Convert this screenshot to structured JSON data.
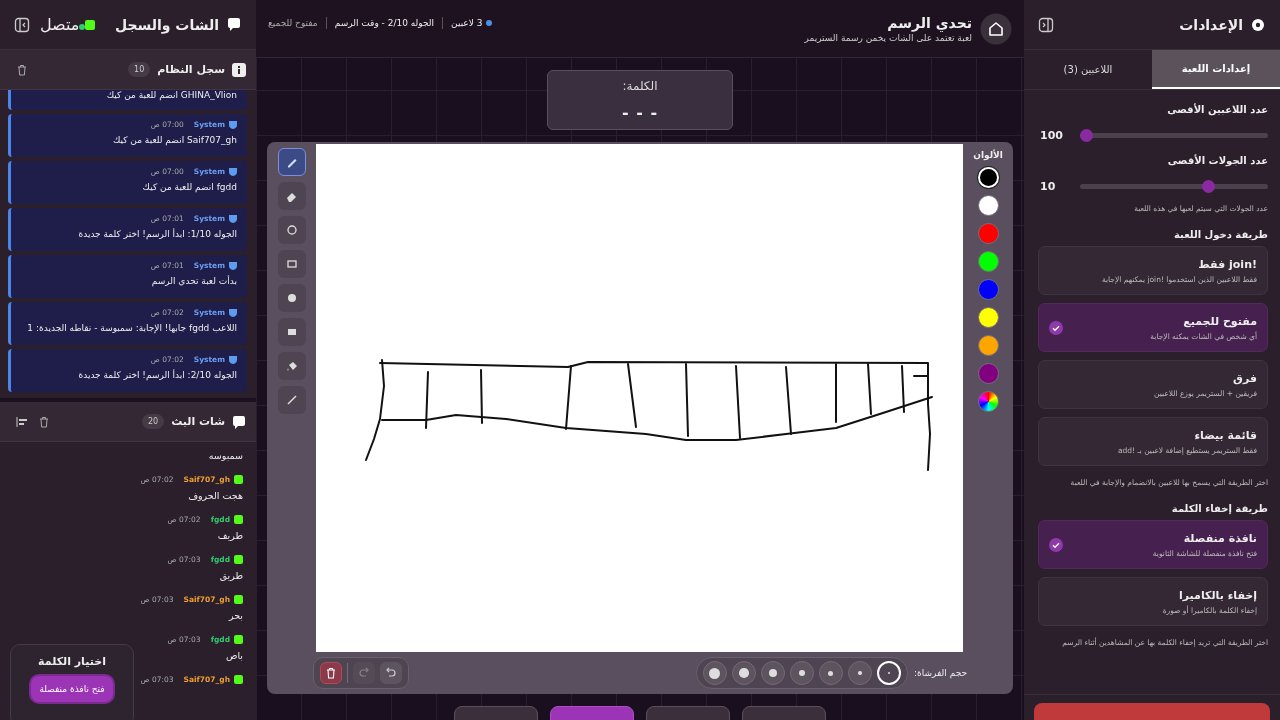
{
  "settings": {
    "title": "الإعدادات",
    "tabs": [
      {
        "label": "إعدادات اللعبة",
        "selected": true
      },
      {
        "label": "اللاعبين (3)",
        "selected": false
      }
    ],
    "sliders": [
      {
        "label": "عدد اللاعبين الأقصى",
        "value": "100"
      },
      {
        "label": "عدد الجولات الأقصى",
        "value": "10",
        "hint": "عدد الجولات التي سيتم لعبها في هذه اللعبة"
      }
    ],
    "groups": [
      {
        "title": "طريقة دخول اللعبة",
        "hint": "اختر الطريقة التي يسمح بها للاعبين بالانضمام والإجابة في اللعبة",
        "options": [
          {
            "title": "!join فقط",
            "description": "فقط اللاعبين الذين استخدموا !join يمكنهم الإجابة",
            "selected": false
          },
          {
            "title": "مفتوح للجميع",
            "description": "أي شخص في الشات يمكنه الإجابة",
            "selected": true
          },
          {
            "title": "فرق",
            "description": "فريقين + الستريمر يوزع اللاعبين",
            "selected": false
          },
          {
            "title": "قائمة بيضاء",
            "description": "فقط الستريمر يستطيع إضافة لاعبين بـ !add",
            "selected": false
          }
        ]
      },
      {
        "title": "طريقة إخفاء الكلمة",
        "hint": "اختر الطريقة التي تريد إخفاء الكلمة بها عن المشاهدين أثناء الرسم",
        "options": [
          {
            "title": "نافذة منفصلة",
            "description": "فتح نافذة منفصلة للشاشة الثانوية",
            "selected": true
          },
          {
            "title": "إخفاء بالكاميرا",
            "description": "إخفاء الكلمة بالكاميرا أو صورة",
            "selected": false
          }
        ]
      }
    ],
    "footer_button": {
      "kind": "danger"
    }
  },
  "header": {
    "title": "تحدي الرسم",
    "subtitle": "لعبة تعتمد على الشات يخمن رسمة الستريمر",
    "players": "3 لاعبين",
    "round": "الجوله 2/10 - وقت الرسم",
    "mode": "مفتوح للجميع"
  },
  "word_box": {
    "label": "الكلمة:",
    "value": "- - -"
  },
  "palette": {
    "title": "الألوان",
    "colors": [
      {
        "color": "#000000",
        "selected": true
      },
      {
        "color": "#ffffff",
        "selected": false
      },
      {
        "color": "#ff0000",
        "selected": false
      },
      {
        "color": "#00ff00",
        "selected": false
      },
      {
        "color": "#0000ff",
        "selected": false
      },
      {
        "color": "#ffff00",
        "selected": false
      },
      {
        "color": "#ffa500",
        "selected": false
      },
      {
        "color": "#800080",
        "selected": false
      },
      {
        "kind": "custom",
        "selected": false
      }
    ]
  },
  "tools": [
    {
      "kind": "pen",
      "selected": true
    },
    {
      "kind": "eraser",
      "selected": false
    },
    {
      "kind": "circle",
      "selected": false
    },
    {
      "kind": "rect",
      "selected": false
    },
    {
      "kind": "circle-fill",
      "selected": false
    },
    {
      "kind": "rect-fill",
      "selected": false
    },
    {
      "kind": "bucket",
      "selected": false
    },
    {
      "kind": "line",
      "selected": false
    }
  ],
  "brush": {
    "label": "حجم الفرشاة:",
    "sizes": [
      {
        "selected": true
      },
      {
        "selected": false
      },
      {
        "selected": false
      },
      {
        "selected": false
      },
      {
        "selected": false
      },
      {
        "selected": false
      },
      {
        "selected": false
      }
    ]
  },
  "actions": [
    {
      "kind": "undo",
      "disabled": false
    },
    {
      "kind": "redo",
      "disabled": true
    }
  ],
  "bottom_buttons": [
    {
      "kind": "secondary"
    },
    {
      "kind": "secondary"
    },
    {
      "kind": "primary"
    },
    {
      "kind": "secondary"
    }
  ],
  "chat": {
    "title": "الشات والسجل",
    "status": "متصل",
    "log": {
      "title": "سجل النظام",
      "count": "10",
      "messages": [
        {
          "text": "GHINA_Vlion انضم للعبة من كيك"
        },
        {
          "author": "System",
          "time": "07:00 ص",
          "text": "Saif707_gh انضم للعبة من كيك"
        },
        {
          "author": "System",
          "time": "07:00 ص",
          "text": "fgdd انضم للعبة من كيك"
        },
        {
          "author": "System",
          "time": "07:01 ص",
          "text": "الجوله 1/10: ابدأ الرسم! اختر كلمة جديدة"
        },
        {
          "author": "System",
          "time": "07:01 ص",
          "text": "بدأت لعبة تحدي الرسم"
        },
        {
          "author": "System",
          "time": "07:02 ص",
          "text": "اللاعب fgdd جابها! الإجابة: سمبوسة - نقاطه الجديدة: 1"
        },
        {
          "author": "System",
          "time": "07:02 ص",
          "text": "الجوله 2/10: ابدأ الرسم! اختر كلمة جديدة"
        }
      ]
    },
    "stream": {
      "title": "شات البث",
      "count": "20",
      "messages": [
        {
          "text": "سمبوسه"
        },
        {
          "author": "Saif707_gh",
          "color": "#f0a030",
          "time": "07:02 ص",
          "text": "هجت الحروف"
        },
        {
          "author": "fgdd",
          "color": "#2ecc71",
          "time": "07:02 ص",
          "text": "طريف"
        },
        {
          "author": "fgdd",
          "color": "#2ecc71",
          "time": "07:03 ص",
          "text": "طريق"
        },
        {
          "author": "Saif707_gh",
          "color": "#f0a030",
          "time": "07:03 ص",
          "text": "بحر"
        },
        {
          "author": "fgdd",
          "color": "#2ecc71",
          "time": "07:03 ص",
          "text": "باص"
        },
        {
          "author": "Saif707_gh",
          "color": "#f0a030",
          "time": "07:03 ص"
        }
      ]
    }
  },
  "word_picker": {
    "title": "اختيار الكلمة",
    "button": "فتح نافذة منفصلة"
  }
}
